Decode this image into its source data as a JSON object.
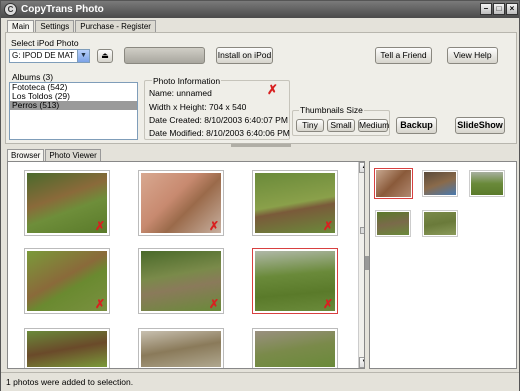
{
  "window": {
    "title": "CopyTrans Photo",
    "min": "–",
    "max": "□",
    "close": "×"
  },
  "menu_tabs": [
    "Main",
    "Settings",
    "Purchase - Register"
  ],
  "ipod": {
    "section_label": "Select iPod Photo",
    "selected": "G: IPOD DE MAT"
  },
  "toolbar": {
    "install_label": "Install on iPod",
    "tell_friend_label": "Tell a Friend",
    "view_help_label": "View Help"
  },
  "albums": {
    "label": "Albums",
    "count": "(3)",
    "items": [
      "Fototeca (542)",
      "Los Toldos (29)",
      "Perros (513)"
    ],
    "selected_index": 2
  },
  "photo_info": {
    "label": "Photo Information",
    "name": "Name: unnamed",
    "size": "Width x Height: 704 x 540",
    "created": "Date Created: 8/10/2003 6:40:07 PM",
    "modified": "Date Modified: 8/10/2003 6:40:06 PM"
  },
  "thumbnails": {
    "label": "Thumbnails Size",
    "options": [
      "Tiny",
      "Small",
      "Medium"
    ]
  },
  "actions": {
    "backup_label": "Backup",
    "slideshow_label": "SlideShow"
  },
  "view_tabs": [
    "Browser",
    "Photo Viewer"
  ],
  "status": "1 photos were added to selection.",
  "colors": {
    "selection_border": "#d84040",
    "no_ipod_mark": "#d82020",
    "list_selected": "#9a9a9a"
  }
}
